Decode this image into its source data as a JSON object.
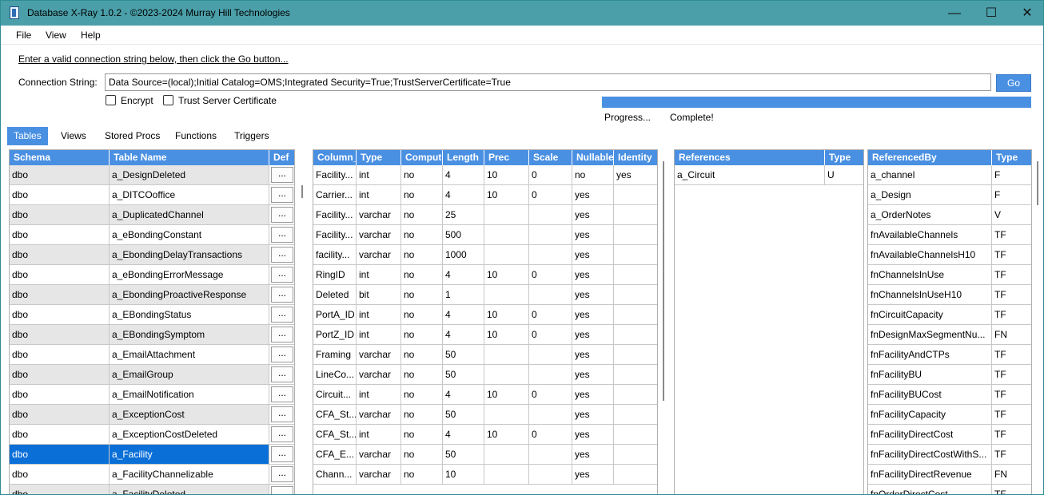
{
  "titlebar": {
    "title": "Database X-Ray 1.0.2 - ©2023-2024 Murray Hill Technologies",
    "minimize": "—",
    "maximize": "☐",
    "close": "✕"
  },
  "menu": [
    "File",
    "View",
    "Help"
  ],
  "connection": {
    "hint": "Enter a valid connection string below, then click the Go button...",
    "label": "Connection String:",
    "value": "Data Source=(local);Initial Catalog=OMS;Integrated Security=True;TrustServerCertificate=True",
    "go_label": "Go",
    "encrypt_label": "Encrypt",
    "trust_label": "Trust Server Certificate",
    "progress_label": "Progress...",
    "status": "Complete!",
    "progress_fraction": 1.0,
    "accent_color": "#4a90e2"
  },
  "tabs": [
    "Tables",
    "Views",
    "Stored Procs",
    "Functions",
    "Triggers"
  ],
  "tables_grid": {
    "headers": [
      "Schema",
      "Table Name",
      "Def"
    ],
    "button_label": "...",
    "rows": [
      [
        "dbo",
        "a_DesignDeleted"
      ],
      [
        "dbo",
        "a_DITCOoffice"
      ],
      [
        "dbo",
        "a_DuplicatedChannel"
      ],
      [
        "dbo",
        "a_eBondingConstant"
      ],
      [
        "dbo",
        "a_EbondingDelayTransactions"
      ],
      [
        "dbo",
        "a_eBondingErrorMessage"
      ],
      [
        "dbo",
        "a_EbondingProactiveResponse"
      ],
      [
        "dbo",
        "a_EBondingStatus"
      ],
      [
        "dbo",
        "a_EBondingSymptom"
      ],
      [
        "dbo",
        "a_EmailAttachment"
      ],
      [
        "dbo",
        "a_EmailGroup"
      ],
      [
        "dbo",
        "a_EmailNotification"
      ],
      [
        "dbo",
        "a_ExceptionCost"
      ],
      [
        "dbo",
        "a_ExceptionCostDeleted"
      ],
      [
        "dbo",
        "a_Facility"
      ],
      [
        "dbo",
        "a_FacilityChannelizable"
      ],
      [
        "dbo",
        "a_FacilityDeleted"
      ]
    ],
    "selected_row": 14
  },
  "columns_grid": {
    "headers": [
      "Column_",
      "Type",
      "Comput",
      "Length",
      "Prec",
      "Scale",
      "Nullable",
      "Identity"
    ],
    "rows": [
      [
        "Facility...",
        "int",
        "no",
        "4",
        "10",
        "0",
        "no",
        "yes"
      ],
      [
        "Carrier...",
        "int",
        "no",
        "4",
        "10",
        "0",
        "yes",
        ""
      ],
      [
        "Facility...",
        "varchar",
        "no",
        "25",
        "",
        "",
        "yes",
        ""
      ],
      [
        "Facility...",
        "varchar",
        "no",
        "500",
        "",
        "",
        "yes",
        ""
      ],
      [
        "facility...",
        "varchar",
        "no",
        "1000",
        "",
        "",
        "yes",
        ""
      ],
      [
        "RingID",
        "int",
        "no",
        "4",
        "10",
        "0",
        "yes",
        ""
      ],
      [
        "Deleted",
        "bit",
        "no",
        "1",
        "",
        "",
        "yes",
        ""
      ],
      [
        "PortA_ID",
        "int",
        "no",
        "4",
        "10",
        "0",
        "yes",
        ""
      ],
      [
        "PortZ_ID",
        "int",
        "no",
        "4",
        "10",
        "0",
        "yes",
        ""
      ],
      [
        "Framing",
        "varchar",
        "no",
        "50",
        "",
        "",
        "yes",
        ""
      ],
      [
        "LineCo...",
        "varchar",
        "no",
        "50",
        "",
        "",
        "yes",
        ""
      ],
      [
        "Circuit...",
        "int",
        "no",
        "4",
        "10",
        "0",
        "yes",
        ""
      ],
      [
        "CFA_St...",
        "varchar",
        "no",
        "50",
        "",
        "",
        "yes",
        ""
      ],
      [
        "CFA_St...",
        "int",
        "no",
        "4",
        "10",
        "0",
        "yes",
        ""
      ],
      [
        "CFA_E...",
        "varchar",
        "no",
        "50",
        "",
        "",
        "yes",
        ""
      ],
      [
        "Chann...",
        "varchar",
        "no",
        "10",
        "",
        "",
        "yes",
        ""
      ]
    ]
  },
  "references_grid": {
    "headers": [
      "References",
      "Type"
    ],
    "rows": [
      [
        "a_Circuit",
        "U"
      ]
    ]
  },
  "referencedby_grid": {
    "headers": [
      "ReferencedBy",
      "Type"
    ],
    "rows": [
      [
        "a_channel",
        "F"
      ],
      [
        "a_Design",
        "F"
      ],
      [
        "a_OrderNotes",
        "V"
      ],
      [
        "fnAvailableChannels",
        "TF"
      ],
      [
        "fnAvailableChannelsH10",
        "TF"
      ],
      [
        "fnChannelsInUse",
        "TF"
      ],
      [
        "fnChannelsInUseH10",
        "TF"
      ],
      [
        "fnCircuitCapacity",
        "TF"
      ],
      [
        "fnDesignMaxSegmentNu...",
        "FN"
      ],
      [
        "fnFacilityAndCTPs",
        "TF"
      ],
      [
        "fnFacilityBU",
        "TF"
      ],
      [
        "fnFacilityBUCost",
        "TF"
      ],
      [
        "fnFacilityCapacity",
        "TF"
      ],
      [
        "fnFacilityDirectCost",
        "TF"
      ],
      [
        "fnFacilityDirectCostWithS...",
        "TF"
      ],
      [
        "fnFacilityDirectRevenue",
        "FN"
      ],
      [
        "fnOrderDirectCost",
        "TF"
      ]
    ]
  }
}
